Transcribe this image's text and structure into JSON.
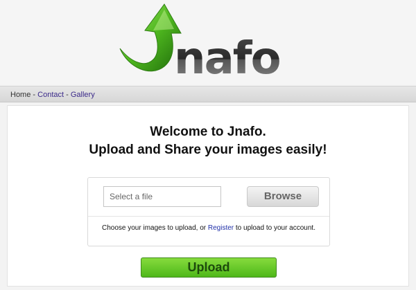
{
  "logo": {
    "text": "Jnafo",
    "accent_color": "#4caf24",
    "text_color": "#3a3a3a"
  },
  "nav": {
    "items": [
      {
        "label": "Home"
      },
      {
        "label": "Contact"
      },
      {
        "label": "Gallery"
      }
    ],
    "separator": "-"
  },
  "welcome": {
    "line1": "Welcome to Jnafo.",
    "line2": "Upload and Share your images easily!"
  },
  "upload_form": {
    "file_placeholder": "Select a file",
    "browse_label": "Browse",
    "info_before": "Choose your images to upload, or ",
    "register_link": "Register",
    "info_after": " to upload to your account.",
    "upload_label": "Upload"
  }
}
